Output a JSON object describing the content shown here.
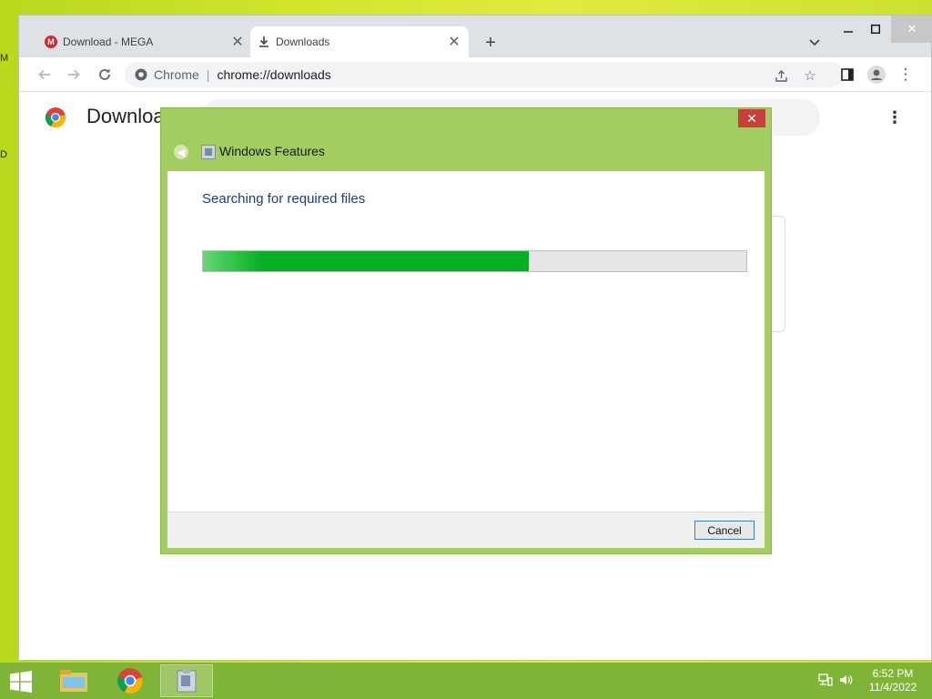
{
  "desktop": {
    "edge_letters": [
      "M",
      "D"
    ]
  },
  "browser": {
    "tabs": [
      {
        "label": "Download - MEGA",
        "icon": "mega-icon",
        "active": false
      },
      {
        "label": "Downloads",
        "icon": "download-icon",
        "active": true
      }
    ],
    "omnibox": {
      "scheme_label": "Chrome",
      "url": "chrome://downloads"
    },
    "page_title": "Downloads"
  },
  "dialog": {
    "title": "Windows Features",
    "message": "Searching for required files",
    "progress_fraction": 0.6,
    "cancel_label": "Cancel",
    "close_glyph": "✕"
  },
  "taskbar": {
    "items": [
      "file-explorer",
      "chrome",
      "windows-features"
    ],
    "clock": {
      "time": "6:52 PM",
      "date": "11/4/2022"
    }
  },
  "colors": {
    "taskbar": "#7fb436",
    "dialog_frame": "#a3cd60",
    "progress_fill": "#06b025",
    "close_button": "#c7403a"
  }
}
